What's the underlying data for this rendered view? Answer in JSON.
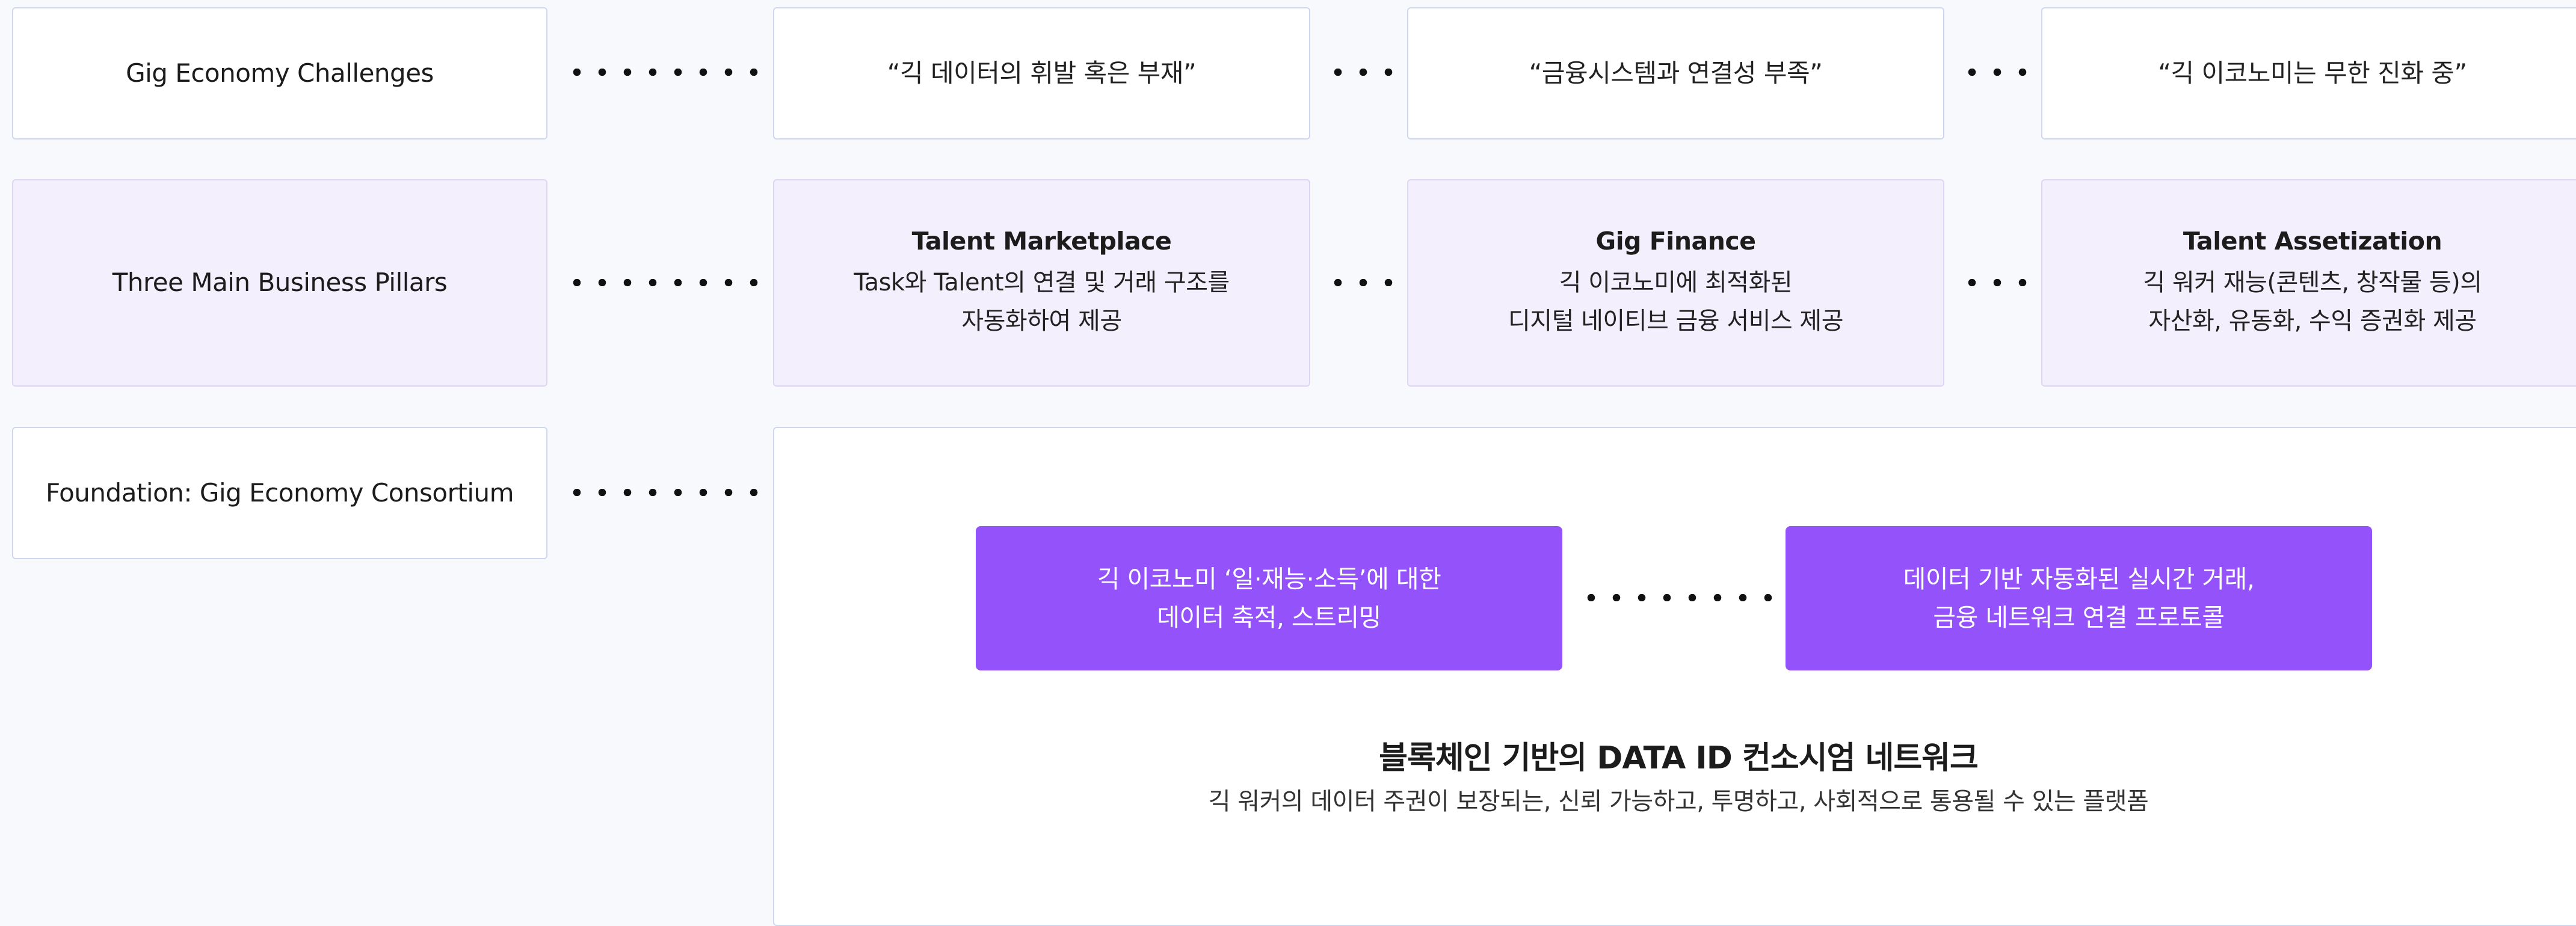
{
  "rows": {
    "challenges": {
      "label": "Gig Economy Challenges",
      "items": [
        "“긱 데이터의 휘발 혹은 부재”",
        "“금융시스템과 연결성 부족”",
        "“긱 이코노미는 무한 진화 중”"
      ]
    },
    "pillars": {
      "label": "Three Main Business Pillars",
      "items": [
        {
          "title": "Talent Marketplace",
          "lines": [
            "Task와 Talent의 연결 및 거래 구조를",
            "자동화하여 제공"
          ]
        },
        {
          "title": "Gig Finance",
          "lines": [
            "긱 이코노미에 최적화된",
            "디지털 네이티브 금융 서비스 제공"
          ]
        },
        {
          "title": "Talent Assetization",
          "lines": [
            "긱 워커 재능(콘텐츠, 창작물 등)의",
            "자산화, 유동화, 수익 증권화 제공"
          ]
        }
      ]
    },
    "foundation": {
      "label": "Foundation: Gig Economy Consortium",
      "blocks": [
        [
          "긱 이코노미 ‘일·재능·소득’에 대한",
          "데이터 축적, 스트리밍"
        ],
        [
          "데이터 기반 자동화된 실시간 거래,",
          "금융 네트워크 연결 프로토콜"
        ]
      ],
      "network_title": "블록체인 기반의 DATA ID 컨소시엄 네트워크",
      "network_subtitle": "긱 워커의 데이터 주권이 보장되는, 신뢰 가능하고, 투명하고, 사회적으로 통용될 수 있는 플랫폼"
    }
  },
  "colors": {
    "background": "#f8f9fd",
    "box_border": "#cfd6ef",
    "pillar_fill": "#f3effd",
    "accent_purple": "#9452fb"
  }
}
